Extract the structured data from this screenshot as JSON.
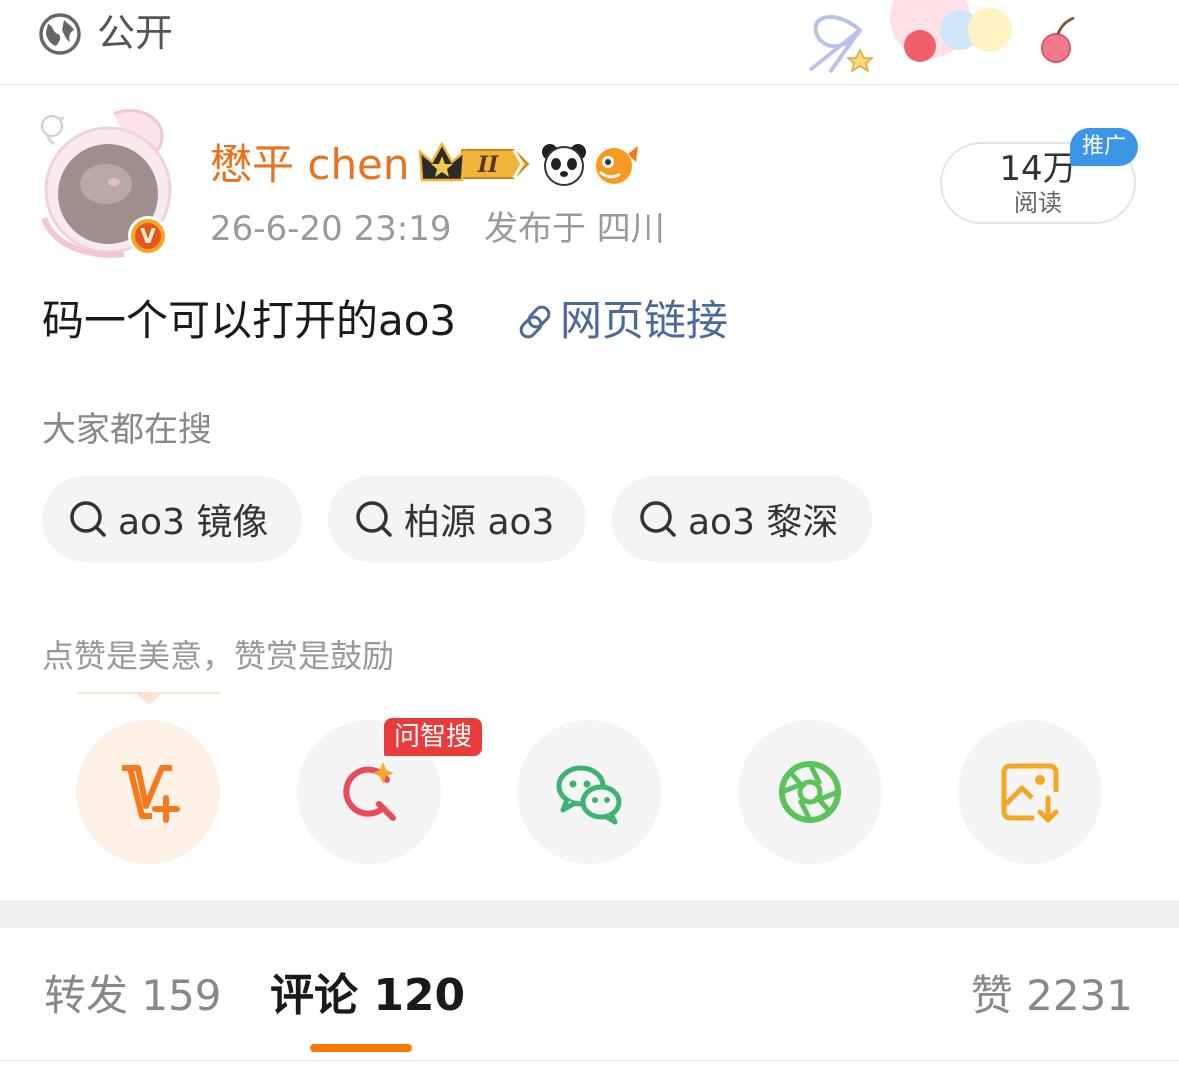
{
  "top_bar": {
    "visibility_label": "公开",
    "icon": "globe-icon"
  },
  "author": {
    "name": "懋平 chen",
    "verified_badge": "V",
    "badges": [
      "crown-level-icon",
      "panda-icon",
      "fish-icon"
    ],
    "crown_level": "II",
    "name_color": "#e8731f"
  },
  "post": {
    "time": "26-6-20 23:19",
    "location": "发布于 四川",
    "text": "码一个可以打开的ao3",
    "link_label": "网页链接",
    "link_color": "#4a6a9c"
  },
  "reads": {
    "count": "14万",
    "label": "阅读",
    "promo_tag": "推广"
  },
  "search_suggestions": {
    "title": "大家都在搜",
    "items": [
      "ao3 镜像",
      "柏源 ao3",
      "ao3 黎深"
    ]
  },
  "reward": {
    "prompt": "点赞是美意，赞赏是鼓励",
    "ai_search_badge": "问智搜",
    "actions": [
      "v-plus-icon",
      "ai-search-icon",
      "wechat-icon",
      "moments-icon",
      "save-image-icon"
    ]
  },
  "tabs": {
    "repost": "转发 159",
    "comment": "评论 120",
    "like": "赞 2231",
    "active": "comment",
    "accent": "#f57c00"
  }
}
